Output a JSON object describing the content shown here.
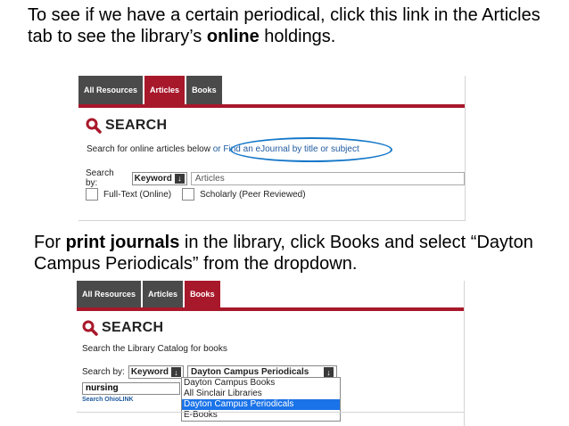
{
  "captions": {
    "top": {
      "pre": "To see if we have a certain periodical, click this link in the Articles tab to see the library’s ",
      "bold": "online",
      "post": " holdings."
    },
    "bottom": {
      "pre": "For ",
      "bold": "print journals",
      "post": " in the library, click Books and select “Dayton Campus Periodicals” from the dropdown."
    }
  },
  "panel1": {
    "tabs": [
      "All Resources",
      "Articles",
      "Books"
    ],
    "active_tab": "Articles",
    "search_title": "SEARCH",
    "subtitle": "Search for online articles below",
    "subtitle_link": "or Find an eJournal by title or subject",
    "search_by_label": "Search by:",
    "search_by_value": "Keyword",
    "field_value": "Articles",
    "checkboxes": [
      "Full-Text (Online)",
      "Scholarly (Peer Reviewed)"
    ]
  },
  "panel2": {
    "tabs": [
      "All Resources",
      "Articles",
      "Books"
    ],
    "active_tab": "Books",
    "search_title": "SEARCH",
    "subtitle": "Search the Library Catalog for books",
    "search_by_label": "Search by:",
    "search_by_value": "Keyword",
    "select_value": "Dayton Campus Periodicals",
    "query": "nursing",
    "ohiolink": "Search OhioLINK",
    "options": [
      "Dayton Campus Books",
      "All Sinclair Libraries",
      "Dayton Campus Periodicals",
      "E-Books"
    ],
    "selected_option": "Dayton Campus Periodicals"
  },
  "colors": {
    "accent": "#a8182b",
    "tab_dark": "#4a4a4a",
    "link": "#1f5a9f",
    "highlight": "#1a73e8"
  }
}
